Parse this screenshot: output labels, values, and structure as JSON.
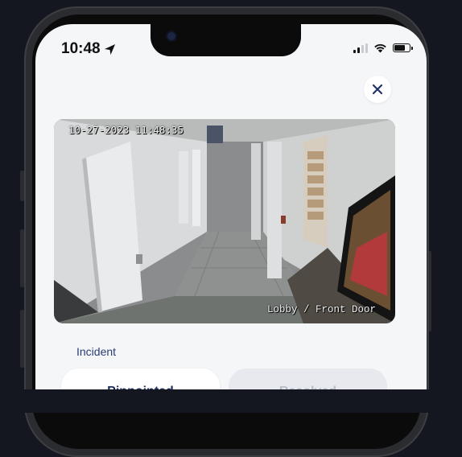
{
  "status_bar": {
    "time": "10:48",
    "location_icon": "location-arrow-icon",
    "signal_icon": "cellular-signal-icon",
    "wifi_icon": "wifi-icon",
    "battery_icon": "battery-icon"
  },
  "modal": {
    "close_icon": "close-icon",
    "camera_feed": {
      "timestamp": "10-27-2023 11:48:35",
      "location": "Lobby / Front Door"
    },
    "section_label": "Incident",
    "options": [
      {
        "label": "Pinpointed"
      },
      {
        "label": "Resolved"
      }
    ]
  },
  "colors": {
    "accent": "#2a3c72",
    "screen_bg": "#f5f6f8",
    "page_bg": "#14171f"
  }
}
